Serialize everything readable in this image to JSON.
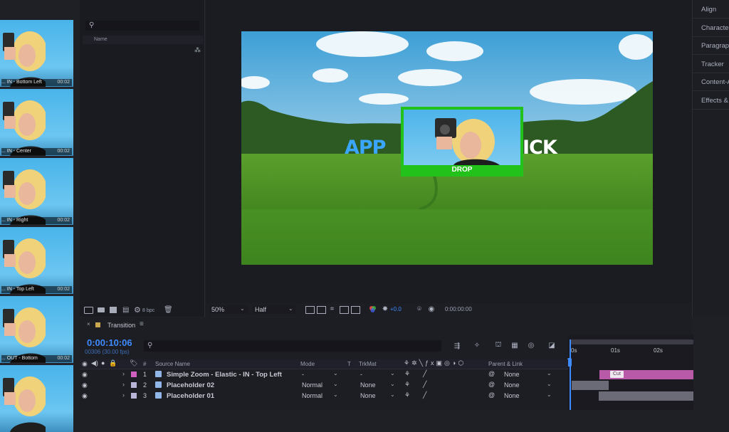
{
  "project_panel": {
    "search_icon": "magnifier-icon",
    "column_name": "Name",
    "footer_bpc": "8 bpc"
  },
  "thumbnails": [
    {
      "label": "... IN - Bottom Left",
      "time": "00:02"
    },
    {
      "label": "... IN - Center",
      "time": "00:02"
    },
    {
      "label": "... IN - Right",
      "time": "00:02"
    },
    {
      "label": "... IN - Top Left",
      "time": "00:02"
    },
    {
      "label": "... OUT - Bottom",
      "time": "00:02"
    },
    {
      "label": "",
      "time": ""
    }
  ],
  "composition": {
    "text_left": "APP",
    "text_right": "ICK",
    "card_label": "DROP",
    "accent_green": "#22c21a",
    "text_blue": "#3aa6ff"
  },
  "viewer_toolbar": {
    "zoom": "50%",
    "resolution": "Half",
    "exposure": "+0.0",
    "timecode": "0:00:00:00"
  },
  "right_panels": [
    "Align",
    "Character",
    "Paragraph",
    "Tracker",
    "Content-Aware",
    "Effects &"
  ],
  "timeline": {
    "tab_label": "Transition",
    "current_time": "0:00:10:06",
    "frame_info": "00306 (30.00 fps)",
    "headers": {
      "source_name": "Source Name",
      "mode": "Mode",
      "t": "T",
      "trkmat": "TrkMat",
      "parent": "Parent & Link",
      "num": "#"
    },
    "ruler": [
      "0s",
      "01s",
      "02s"
    ],
    "marker_label": "Cut",
    "layers": [
      {
        "num": "1",
        "name": "Simple Zoom - Elastic - IN - Top Left",
        "mode": "-",
        "trkmat": "-",
        "parent": "None",
        "label_color": "#d060c0"
      },
      {
        "num": "2",
        "name": "Placeholder 02",
        "mode": "Normal",
        "trkmat": "None",
        "parent": "None",
        "label_color": "#b9b5d8"
      },
      {
        "num": "3",
        "name": "Placeholder 01",
        "mode": "Normal",
        "trkmat": "None",
        "parent": "None",
        "label_color": "#b9b5d8"
      }
    ]
  }
}
